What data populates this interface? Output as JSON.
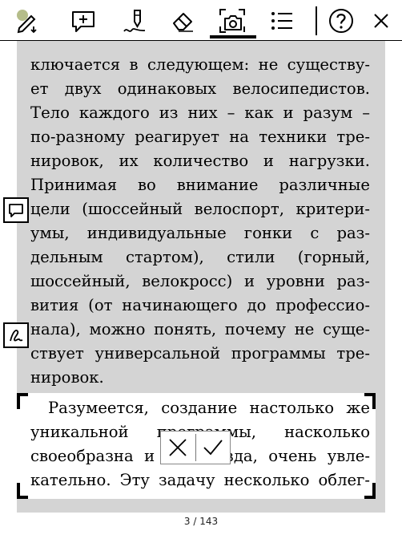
{
  "toolbar": {
    "icons": [
      "annotation-tool-icon",
      "add-note-icon",
      "pen-icon",
      "eraser-icon",
      "screenshot-icon",
      "list-icon",
      "help-icon",
      "close-icon"
    ],
    "active_tool": "screenshot-icon"
  },
  "body_text": {
    "lines": [
      "ключается в следующем: не существу-",
      "ет двух одинаковых велосипедистов.",
      "Тело каждого из них – как и разум –",
      "по-разному реагирует на техники тре-",
      "нировок, их количество и нагрузки.",
      "Принимая во внимание различные",
      "цели (шоссейный велоспорт, критери-",
      "умы, индивидуальные гонки с раз-",
      "дельным стартом), стили (горный,",
      "шоссейный, велокросс) и уровни раз-",
      "вития (от начинающего до профессио-",
      "нала), можно понять, почему не суще-",
      "ствует универсальной программы тре-",
      "нировок."
    ]
  },
  "selected_text": {
    "lines": [
      "Разумеется, создание настолько же",
      "уникальной программы, насколько",
      "своеобразна и сама езда, очень увле-",
      "кательно. Эту задачу несколько облег-"
    ]
  },
  "side_buttons": [
    "note-icon",
    "handwriting-icon"
  ],
  "confirm": [
    "cancel-icon",
    "confirm-icon"
  ],
  "footer": {
    "page_indicator": "3 / 143"
  },
  "colors": {
    "page_bg": "#d4d4d4",
    "selection_bg": "#ffffff",
    "accent": "#b5bd8a"
  }
}
